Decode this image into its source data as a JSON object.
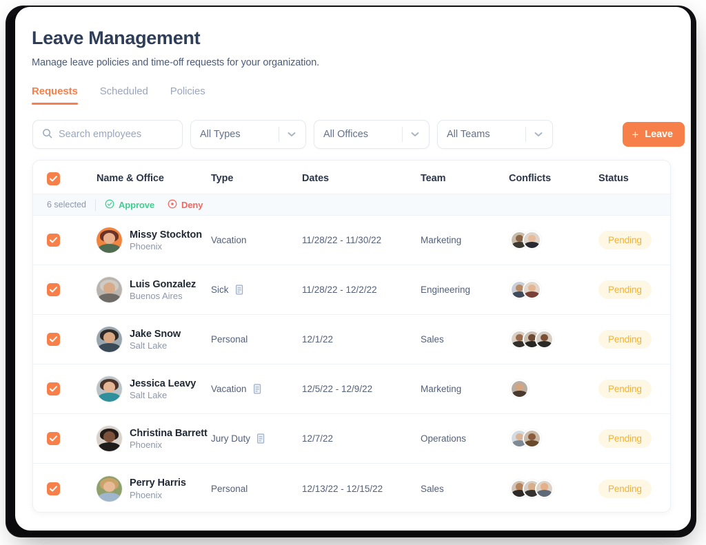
{
  "header": {
    "title": "Leave Management",
    "subtitle": "Manage leave policies and time-off requests for your organization."
  },
  "tabs": [
    {
      "label": "Requests",
      "active": true
    },
    {
      "label": "Scheduled",
      "active": false
    },
    {
      "label": "Policies",
      "active": false
    }
  ],
  "toolbar": {
    "search_placeholder": "Search employees",
    "search_value": "",
    "search_icon": "search-icon",
    "filters": [
      {
        "name": "types",
        "value": "All Types"
      },
      {
        "name": "offices",
        "value": "All Offices"
      },
      {
        "name": "teams",
        "value": "All Teams"
      }
    ],
    "add_button": {
      "label": "Leave",
      "plus": "+"
    }
  },
  "table": {
    "columns": [
      "Name & Office",
      "Type",
      "Dates",
      "Team",
      "Conflicts",
      "Status"
    ],
    "select_all_checked": true,
    "selection_bar": {
      "count_label": "6 selected",
      "approve_label": "Approve",
      "deny_label": "Deny",
      "approve_icon": "check-circle-icon",
      "deny_icon": "deny-circle-icon"
    },
    "rows": [
      {
        "checked": true,
        "name": "Missy Stockton",
        "office": "Phoenix",
        "type": "Vacation",
        "has_note": false,
        "dates": "11/28/22 - 11/30/22",
        "team": "Marketing",
        "conflicts": 2,
        "status": "Pending",
        "avatar": {
          "bg": "#f0853f",
          "hair": "#6b3327",
          "skin": "#e8b08c",
          "body": "#4f6b52"
        },
        "conflict_avatars": [
          {
            "bg": "#c8bba8",
            "skin": "#8b6347",
            "body": "#3c3832"
          },
          {
            "bg": "#ded4c9",
            "skin": "#e7bb9b",
            "body": "#2a2a32"
          }
        ]
      },
      {
        "checked": true,
        "name": "Luis Gonzalez",
        "office": "Buenos Aires",
        "type": "Sick",
        "has_note": true,
        "dates": "11/28/22 - 12/2/22",
        "team": "Engineering",
        "conflicts": 2,
        "status": "Pending",
        "avatar": {
          "bg": "#b9b4ae",
          "hair": "#cfcac4",
          "skin": "#d7ab89",
          "body": "#6e6a66"
        },
        "conflict_avatars": [
          {
            "bg": "#c9ced6",
            "skin": "#b98a63",
            "body": "#3f4a5c"
          },
          {
            "bg": "#e3d7cc",
            "skin": "#e5b694",
            "body": "#7a3f36"
          }
        ]
      },
      {
        "checked": true,
        "name": "Jake Snow",
        "office": "Salt Lake",
        "type": "Personal",
        "has_note": false,
        "dates": "12/1/22",
        "team": "Sales",
        "conflicts": 3,
        "status": "Pending",
        "avatar": {
          "bg": "#9aa6ad",
          "hair": "#2d2a28",
          "skin": "#d8a884",
          "body": "#3b4a57"
        },
        "conflict_avatars": [
          {
            "bg": "#d9cfc4",
            "skin": "#9a6a4a",
            "body": "#332f2c"
          },
          {
            "bg": "#cbbfb2",
            "skin": "#6f4a33",
            "body": "#262522"
          },
          {
            "bg": "#d6cec3",
            "skin": "#7a4f36",
            "body": "#2b2a27"
          }
        ]
      },
      {
        "checked": true,
        "name": "Jessica Leavy",
        "office": "Salt Lake",
        "type": "Vacation",
        "has_note": true,
        "dates": "12/5/22 - 12/9/22",
        "team": "Marketing",
        "conflicts": 1,
        "status": "Pending",
        "avatar": {
          "bg": "#bcc3c7",
          "hair": "#4a3429",
          "skin": "#e3b595",
          "body": "#2f8f9b"
        },
        "conflict_avatars": [
          {
            "bg": "#b8ada2",
            "skin": "#d8a47c",
            "body": "#4a3a2e"
          }
        ]
      },
      {
        "checked": true,
        "name": "Christina Barrett",
        "office": "Phoenix",
        "type": "Jury Duty",
        "has_note": true,
        "dates": "12/7/22",
        "team": "Operations",
        "conflicts": 2,
        "status": "Pending",
        "avatar": {
          "bg": "#d8d2cb",
          "hair": "#231c18",
          "skin": "#7d523a",
          "body": "#1f1d1c"
        },
        "conflict_avatars": [
          {
            "bg": "#d3dae2",
            "skin": "#dcb394",
            "body": "#7d8a96"
          },
          {
            "bg": "#c9b9a6",
            "skin": "#8a5c3e",
            "body": "#6b4a2c"
          }
        ]
      },
      {
        "checked": true,
        "name": "Perry Harris",
        "office": "Phoenix",
        "type": "Personal",
        "has_note": false,
        "dates": "12/13/22 - 12/15/22",
        "team": "Sales",
        "conflicts": 3,
        "status": "Pending",
        "avatar": {
          "bg": "#8fa06a",
          "hair": "#caa36a",
          "skin": "#e8bb96",
          "body": "#9fb6cc"
        },
        "conflict_avatars": [
          {
            "bg": "#cfc4b7",
            "skin": "#b5835c",
            "body": "#2e2b28"
          },
          {
            "bg": "#d5cec6",
            "skin": "#d8ae8c",
            "body": "#35332f"
          },
          {
            "bg": "#ddd2c6",
            "skin": "#e3b08a",
            "body": "#5e6a78"
          }
        ]
      }
    ]
  },
  "colors": {
    "accent": "#f7804a",
    "approve": "#3ecf8e",
    "deny": "#f4675f",
    "badge_text": "#f2b134",
    "badge_bg": "#fdf7e4",
    "title": "#2e3e58"
  }
}
